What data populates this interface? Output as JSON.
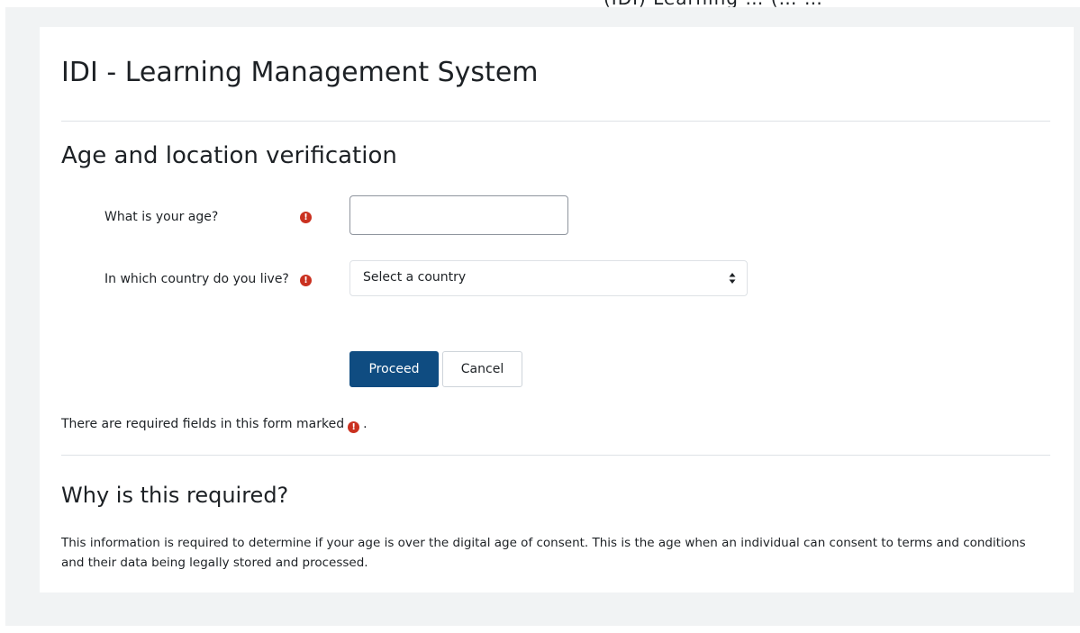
{
  "top_strip_text": "(IDI) Learning … (… …",
  "site": {
    "title": "IDI - Learning Management System"
  },
  "form": {
    "heading": "Age and location verification",
    "age_label": "What is your age?",
    "age_value": "",
    "country_label": "In which country do you live?",
    "country_selected": "Select a country",
    "required_icon_glyph": "!",
    "proceed_label": "Proceed",
    "cancel_label": "Cancel",
    "required_note_before": "There are required fields in this form marked",
    "required_note_after": "."
  },
  "why": {
    "heading": "Why is this required?",
    "body": "This information is required to determine if your age is over the digital age of consent. This is the age when an individual can consent to terms and conditions and their data being legally stored and processed."
  },
  "colors": {
    "primary": "#0f4c81",
    "required": "#ca3120",
    "page_background": "#f1f3f4"
  },
  "icons": {
    "required": "exclamation-circle-icon",
    "select_arrow": "sort-arrows-icon"
  }
}
